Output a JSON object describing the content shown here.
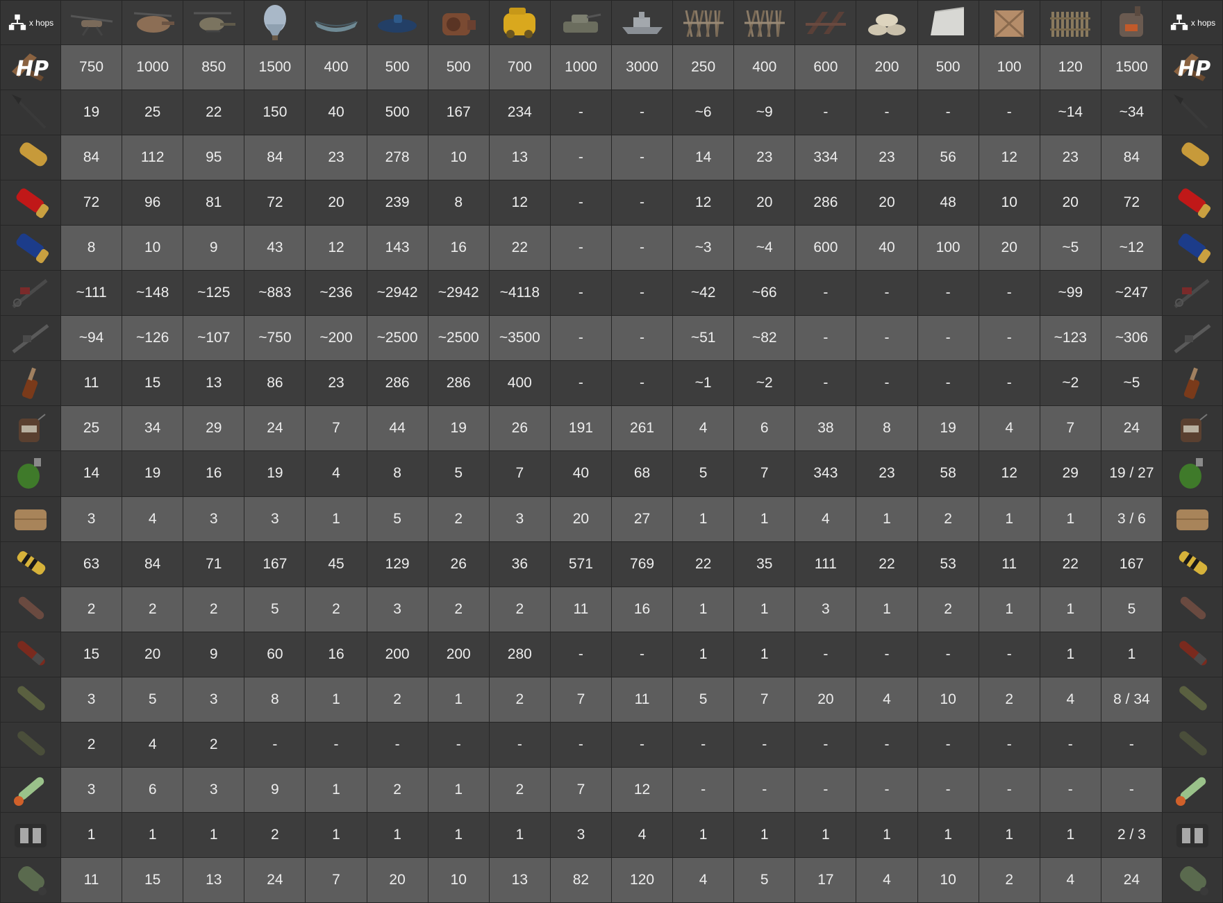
{
  "corner_label": "x hops",
  "hp_label": "HP",
  "targets": [
    {
      "icon": "minicopter-icon"
    },
    {
      "icon": "scrap-helicopter-icon"
    },
    {
      "icon": "attack-helicopter-icon"
    },
    {
      "icon": "hot-air-balloon-icon"
    },
    {
      "icon": "rowboat-icon"
    },
    {
      "icon": "submarine-icon"
    },
    {
      "icon": "engine-module-icon"
    },
    {
      "icon": "armored-car-module-icon"
    },
    {
      "icon": "bradley-apc-icon"
    },
    {
      "icon": "patrol-boat-icon"
    },
    {
      "icon": "wooden-barricade-icon"
    },
    {
      "icon": "barbed-barricade-icon"
    },
    {
      "icon": "metal-barricade-icon"
    },
    {
      "icon": "sandbag-barricade-icon"
    },
    {
      "icon": "concrete-barricade-icon"
    },
    {
      "icon": "wooden-box-icon"
    },
    {
      "icon": "wooden-fence-icon"
    },
    {
      "icon": "furnace-icon"
    }
  ],
  "rows": [
    {
      "icon": "hp-icon",
      "hp": true,
      "values": [
        "750",
        "1000",
        "850",
        "1500",
        "400",
        "500",
        "500",
        "700",
        "1000",
        "3000",
        "250",
        "400",
        "600",
        "200",
        "500",
        "100",
        "120",
        "1500"
      ]
    },
    {
      "icon": "spear-icon",
      "values": [
        "19",
        "25",
        "22",
        "150",
        "40",
        "500",
        "167",
        "234",
        "-",
        "-",
        "~6",
        "~9",
        "-",
        "-",
        "-",
        "-",
        "~14",
        "~34"
      ]
    },
    {
      "icon": "handmade-shell-icon",
      "values": [
        "84",
        "112",
        "95",
        "84",
        "23",
        "278",
        "10",
        "13",
        "-",
        "-",
        "14",
        "23",
        "334",
        "23",
        "56",
        "12",
        "23",
        "84"
      ]
    },
    {
      "icon": "shotgun-shell-red-icon",
      "values": [
        "72",
        "96",
        "81",
        "72",
        "20",
        "239",
        "8",
        "12",
        "-",
        "-",
        "12",
        "20",
        "286",
        "20",
        "48",
        "10",
        "20",
        "72"
      ]
    },
    {
      "icon": "shotgun-shell-blue-icon",
      "values": [
        "8",
        "10",
        "9",
        "43",
        "12",
        "143",
        "16",
        "22",
        "-",
        "-",
        "~3",
        "~4",
        "600",
        "40",
        "100",
        "20",
        "~5",
        "~12"
      ]
    },
    {
      "icon": "flamethrower-icon",
      "values": [
        "~111",
        "~148",
        "~125",
        "~883",
        "~236",
        "~2942",
        "~2942",
        "~4118",
        "-",
        "-",
        "~42",
        "~66",
        "-",
        "-",
        "-",
        "-",
        "~99",
        "~247"
      ]
    },
    {
      "icon": "flame-gun-icon",
      "values": [
        "~94",
        "~126",
        "~107",
        "~750",
        "~200",
        "~2500",
        "~2500",
        "~3500",
        "-",
        "-",
        "~51",
        "~82",
        "-",
        "-",
        "-",
        "-",
        "~123",
        "~306"
      ]
    },
    {
      "icon": "molotov-icon",
      "values": [
        "11",
        "15",
        "13",
        "86",
        "23",
        "286",
        "286",
        "400",
        "-",
        "-",
        "~1",
        "~2",
        "-",
        "-",
        "-",
        "-",
        "~2",
        "~5"
      ]
    },
    {
      "icon": "beancan-grenade-icon",
      "values": [
        "25",
        "34",
        "29",
        "24",
        "7",
        "44",
        "19",
        "26",
        "191",
        "261",
        "4",
        "6",
        "38",
        "8",
        "19",
        "4",
        "7",
        "24"
      ]
    },
    {
      "icon": "f1-grenade-icon",
      "values": [
        "14",
        "19",
        "16",
        "19",
        "4",
        "8",
        "5",
        "7",
        "40",
        "68",
        "5",
        "7",
        "343",
        "23",
        "58",
        "12",
        "29",
        "19 / 27"
      ]
    },
    {
      "icon": "satchel-charge-icon",
      "values": [
        "3",
        "4",
        "3",
        "3",
        "1",
        "5",
        "2",
        "3",
        "20",
        "27",
        "1",
        "1",
        "4",
        "1",
        "2",
        "1",
        "1",
        "3 / 6"
      ]
    },
    {
      "icon": "explosive-ammo-icon",
      "values": [
        "63",
        "84",
        "71",
        "167",
        "45",
        "129",
        "26",
        "36",
        "571",
        "769",
        "22",
        "35",
        "111",
        "22",
        "53",
        "11",
        "22",
        "167"
      ]
    },
    {
      "icon": "rocket-icon",
      "values": [
        "2",
        "2",
        "2",
        "5",
        "2",
        "3",
        "2",
        "2",
        "11",
        "16",
        "1",
        "1",
        "3",
        "1",
        "2",
        "1",
        "1",
        "5"
      ]
    },
    {
      "icon": "incendiary-rocket-icon",
      "values": [
        "15",
        "20",
        "9",
        "60",
        "16",
        "200",
        "200",
        "280",
        "-",
        "-",
        "1",
        "1",
        "-",
        "-",
        "-",
        "-",
        "1",
        "1"
      ]
    },
    {
      "icon": "hv-rocket-icon",
      "values": [
        "3",
        "5",
        "3",
        "8",
        "1",
        "2",
        "1",
        "2",
        "7",
        "11",
        "5",
        "7",
        "20",
        "4",
        "10",
        "2",
        "4",
        "8 / 34"
      ]
    },
    {
      "icon": "smoke-rocket-icon",
      "values": [
        "2",
        "4",
        "2",
        "-",
        "-",
        "-",
        "-",
        "-",
        "-",
        "-",
        "-",
        "-",
        "-",
        "-",
        "-",
        "-",
        "-",
        "-"
      ]
    },
    {
      "icon": "mlrs-rocket-icon",
      "values": [
        "3",
        "6",
        "3",
        "9",
        "1",
        "2",
        "1",
        "2",
        "7",
        "12",
        "-",
        "-",
        "-",
        "-",
        "-",
        "-",
        "-",
        "-"
      ]
    },
    {
      "icon": "timed-explosive-icon",
      "values": [
        "1",
        "1",
        "1",
        "2",
        "1",
        "1",
        "1",
        "1",
        "3",
        "4",
        "1",
        "1",
        "1",
        "1",
        "1",
        "1",
        "1",
        "2 / 3"
      ]
    },
    {
      "icon": "40mm-grenade-icon",
      "values": [
        "11",
        "15",
        "13",
        "24",
        "7",
        "20",
        "10",
        "13",
        "82",
        "120",
        "4",
        "5",
        "17",
        "4",
        "10",
        "2",
        "4",
        "24"
      ]
    }
  ],
  "colors": {
    "row_dark": "#3d3d3d",
    "row_light": "#5d5d5d",
    "text": "#ededed"
  }
}
